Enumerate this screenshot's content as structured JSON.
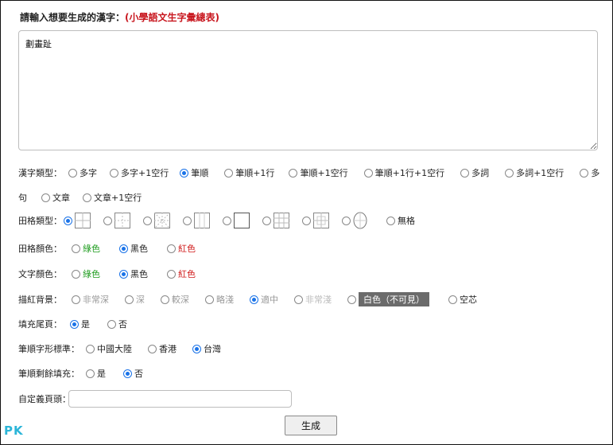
{
  "header": {
    "title": "請輸入想要生成的漢字：",
    "link": "(小學語文生字彙總表)"
  },
  "text_input": {
    "value": "劃畫趾"
  },
  "char_type": {
    "label": "漢字類型：",
    "options": [
      "多字",
      "多字+1空行",
      "筆順",
      "筆順+1行",
      "筆順+1空行",
      "筆順+1行+1空行",
      "多詞",
      "多詞+1空行",
      "多",
      "句",
      "文章",
      "文章+1空行"
    ]
  },
  "grid_type": {
    "label": "田格類型：",
    "none_label": "無格"
  },
  "grid_color": {
    "label": "田格顏色：",
    "options": [
      "綠色",
      "黑色",
      "紅色"
    ]
  },
  "text_color": {
    "label": "文字顏色：",
    "options": [
      "綠色",
      "黑色",
      "紅色"
    ]
  },
  "trace_bg": {
    "label": "描紅背景：",
    "options": [
      "非常深",
      "深",
      "較深",
      "略淺",
      "適中",
      "非常淺",
      "白色（不可見）",
      "空芯"
    ]
  },
  "fill_tail": {
    "label": "填充尾頁：",
    "options": [
      "是",
      "否"
    ]
  },
  "stroke_std": {
    "label": "筆順字形標準：",
    "options": [
      "中國大陸",
      "香港",
      "台灣"
    ]
  },
  "stroke_fill": {
    "label": "筆順剩餘填充：",
    "options": [
      "是",
      "否"
    ]
  },
  "custom_header": {
    "label": "自定義頁頭：",
    "value": ""
  },
  "generate": {
    "label": "生成"
  },
  "watermark": {
    "text": "PK"
  },
  "colors": {
    "accent": "#1a73e8",
    "title_red": "#c8161e",
    "green": "#1e9c1e",
    "red": "#d01a1a"
  }
}
